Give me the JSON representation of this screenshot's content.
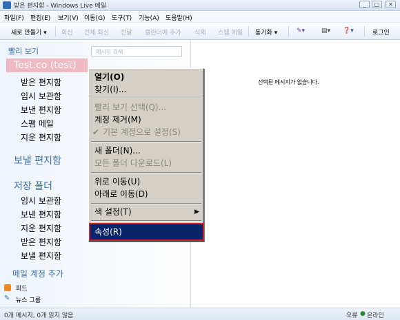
{
  "window": {
    "title": "받은 편지함 - Windows Live 메일",
    "controls": [
      "_",
      "□",
      "✕"
    ]
  },
  "menubar": [
    "파일(F)",
    "편집(E)",
    "보기(V)",
    "이동(G)",
    "도구(T)",
    "기능(A)",
    "도움말(H)"
  ],
  "toolbar": {
    "new_label": "새로 만들기 ▾",
    "reply": "회신",
    "reply_all": "전체 회신",
    "forward": "전달",
    "add_calendar": "캘린더에 추가",
    "delete": "삭제",
    "junk": "스팸 메일",
    "sync": "동기화 ▾",
    "login": "로그인"
  },
  "sidebar": {
    "quick_view": "빨리 보기",
    "search_placeholder": "메시지 검색",
    "account": "Test.co (test)",
    "account_folders": [
      "받은 편지함",
      "임시 보관함",
      "보낸 편지함",
      "스팸 메일",
      "지운 편지함"
    ],
    "outbox": "보낼 편지함",
    "storage": "저장 폴더",
    "storage_folders": [
      "임시 보관함",
      "보낸 편지함",
      "지운 편지함",
      "받은 편지함",
      "보낼 편지함"
    ],
    "add_account": "메일 계정 추가",
    "feeds": "피드",
    "newsgroups": "뉴스 그룹"
  },
  "main": {
    "empty_message": "선택된 메시지가 없습니다."
  },
  "context_menu": {
    "open": "열기(O)",
    "find": "찾기(I)...",
    "quick_view_select": "빨리 보기 선택(Q)...",
    "remove_account": "계정 제거(M)",
    "set_default": "기본 계정으로 설정(S)",
    "new_folder": "새 폴더(N)...",
    "download_all": "모든 폴더 다운로드(L)",
    "move_up": "위로 이동(U)",
    "move_down": "아래로 이동(D)",
    "color_setting": "색 설정(T)",
    "properties": "속성(R)"
  },
  "status": {
    "text": "0개 메시지, 0개 읽지 않음",
    "error": "오류",
    "online": "온라인"
  },
  "colors": {
    "selection": "#0a246a",
    "highlight_border": "#d21f2b",
    "account_bg": "#f0b8c2",
    "heading": "#3b6da8"
  }
}
